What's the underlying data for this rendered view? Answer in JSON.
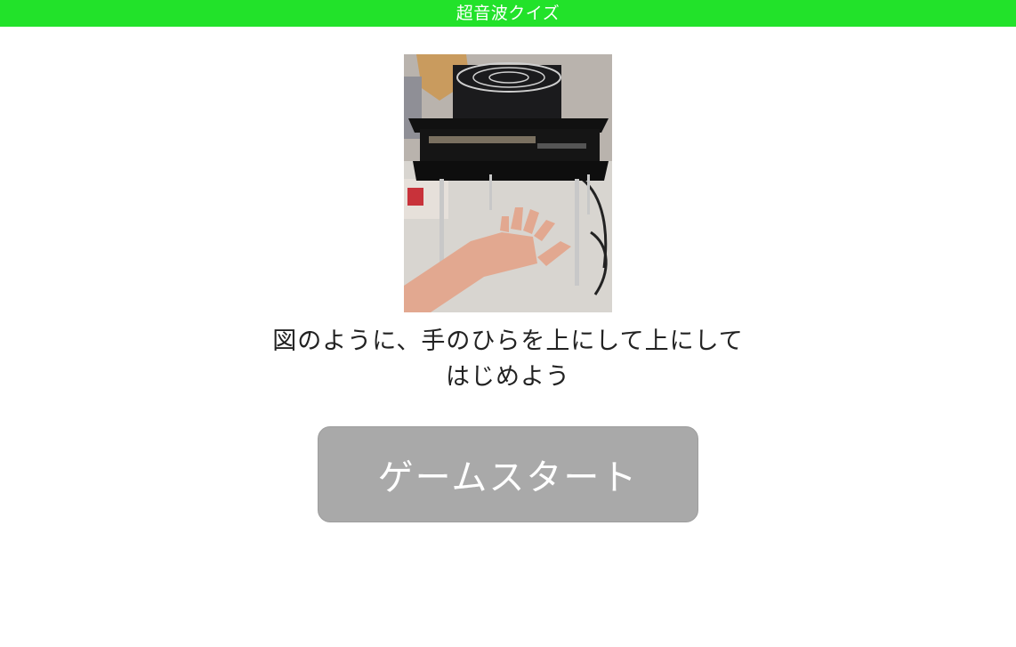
{
  "header": {
    "title": "超音波クイズ",
    "color": "#22e22a"
  },
  "instruction": {
    "line1": "図のように、手のひらを上にして上にして",
    "line2": "はじめよう"
  },
  "start_button": {
    "label": "ゲームスタート",
    "color": "#a9a9a9"
  },
  "photo": {
    "subject": "ultrasonic-sensor-rig-with-hand"
  }
}
